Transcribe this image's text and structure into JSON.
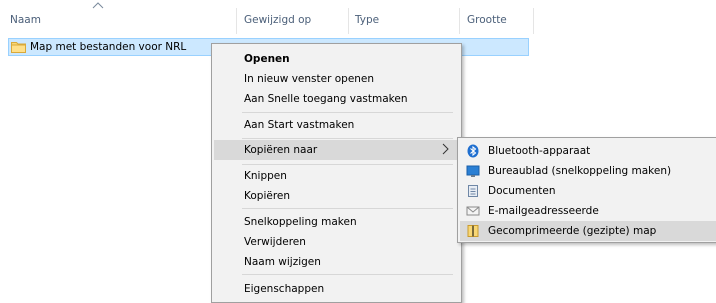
{
  "columns": {
    "name": "Naam",
    "modified": "Gewijzigd op",
    "type": "Type",
    "size": "Grootte"
  },
  "row": {
    "name": "Map met bestanden voor NRL"
  },
  "context_menu": {
    "open": "Openen",
    "open_new_window": "In nieuw venster openen",
    "pin_quick_access": "Aan Snelle toegang vastmaken",
    "pin_start": "Aan Start vastmaken",
    "copy_to": "Kopiëren naar",
    "cut": "Knippen",
    "copy": "Kopiëren",
    "create_shortcut": "Snelkoppeling maken",
    "delete": "Verwijderen",
    "rename": "Naam wijzigen",
    "properties": "Eigenschappen"
  },
  "submenu": {
    "bluetooth": "Bluetooth-apparaat",
    "desktop": "Bureaublad (snelkoppeling maken)",
    "documents": "Documenten",
    "mail": "E-mailgeadresseerde",
    "zip": "Gecomprimeerde (gezipte) map"
  },
  "colors": {
    "selection_fill": "#cce8ff",
    "selection_border": "#99d1ff",
    "menu_background": "#f2f2f2",
    "menu_highlight": "#d9d9d9",
    "header_text": "#4c607a"
  }
}
